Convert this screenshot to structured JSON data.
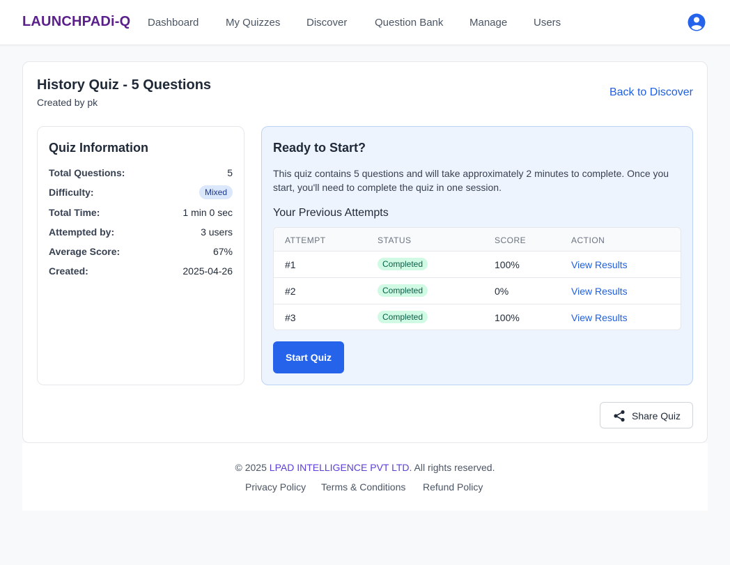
{
  "nav": {
    "brand": "LAUNCHPADi-Q",
    "links": [
      "Dashboard",
      "My Quizzes",
      "Discover",
      "Question Bank",
      "Manage",
      "Users"
    ]
  },
  "quiz": {
    "title": "History Quiz - 5 Questions",
    "created_by": "Created by pk",
    "back_link": "Back to Discover"
  },
  "info": {
    "title": "Quiz Information",
    "rows": [
      {
        "label": "Total Questions:",
        "value": "5"
      },
      {
        "label": "Difficulty:",
        "value": "Mixed"
      },
      {
        "label": "Total Time:",
        "value": "1 min 0 sec"
      },
      {
        "label": "Attempted by:",
        "value": "3 users"
      },
      {
        "label": "Average Score:",
        "value": "67%"
      },
      {
        "label": "Created:",
        "value": "2025-04-26"
      }
    ]
  },
  "ready": {
    "title": "Ready to Start?",
    "description": "This quiz contains 5 questions and will take approximately 2 minutes to complete. Once you start, you'll need to complete the quiz in one session.",
    "attempts_title": "Your Previous Attempts",
    "columns": [
      "ATTEMPT",
      "STATUS",
      "SCORE",
      "ACTION"
    ],
    "attempts": [
      {
        "attempt": "#1",
        "status": "Completed",
        "score": "100%",
        "action": "View Results"
      },
      {
        "attempt": "#2",
        "status": "Completed",
        "score": "0%",
        "action": "View Results"
      },
      {
        "attempt": "#3",
        "status": "Completed",
        "score": "100%",
        "action": "View Results"
      }
    ],
    "start_label": "Start Quiz"
  },
  "share_label": "Share Quiz",
  "footer": {
    "copyright_prefix": "© 2025 ",
    "company": "LPAD INTELLIGENCE PVT LTD.",
    "copyright_suffix": " All rights reserved.",
    "links": [
      "Privacy Policy",
      "Terms & Conditions",
      "Refund Policy"
    ]
  },
  "colors": {
    "brand": "#5b1f8c",
    "primary": "#2563eb",
    "link": "#1d5fe0",
    "success_bg": "#d1fae5",
    "ready_bg": "#eef4fe"
  }
}
